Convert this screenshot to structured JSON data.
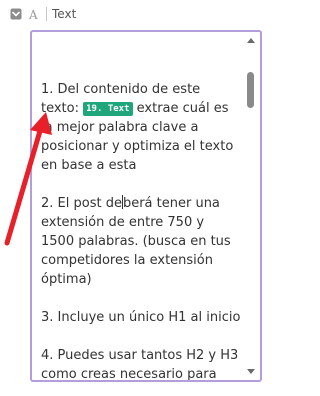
{
  "field": {
    "label": "Text",
    "type_icon_glyph": "A",
    "checkbox_icon": "chevron-square-icon"
  },
  "editor": {
    "line1_before_tag": "1. Del contenido de este texto:",
    "tag_label": "19. Text",
    "line1_after_tag": "extrae cuál es la mejor palabra clave a posicionar y optimiza el texto en base a esta",
    "line2_before_caret": "2. El post de",
    "line2_after_caret": "berá tener una extensión de entre 750 y 1500 palabras. (busca en tus competidores la extensión óptima)",
    "line3": "3. Incluye un único H1 al inicio",
    "line4": "4. Puedes usar tantos H2 y H3 como creas necesario para"
  },
  "colors": {
    "border": "#b39ddb",
    "tag_bg": "#1fa67a",
    "annotation_arrow": "#e8202a"
  }
}
